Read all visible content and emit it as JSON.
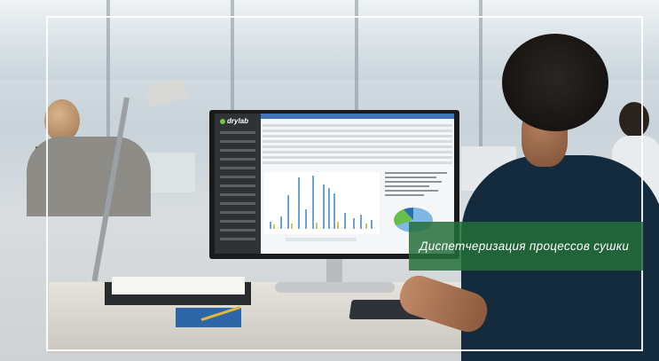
{
  "banner": {
    "caption": "Диспетчеризация процессов сушки"
  },
  "screen_app": {
    "brand": "drylab"
  },
  "colors": {
    "banner_bg": "#246e38",
    "app_accent": "#7ac143",
    "chart_bar_blue": "#6aa5e0",
    "chart_bar_yellow": "#d3c35a"
  }
}
